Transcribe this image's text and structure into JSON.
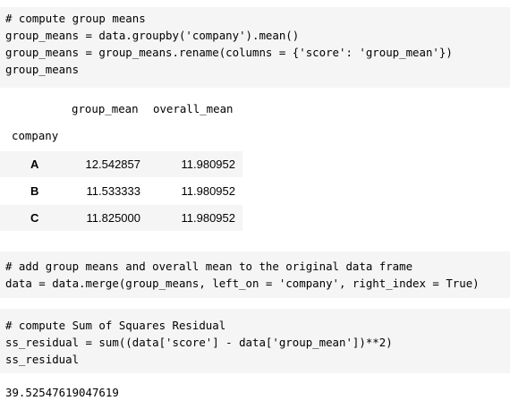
{
  "cell1": {
    "lines": [
      "# compute group means",
      "group_means = data.groupby('company').mean()",
      "group_means = group_means.rename(columns = {'score': 'group_mean'})",
      "group_means"
    ]
  },
  "dataframe": {
    "columns": [
      "group_mean",
      "overall_mean"
    ],
    "index_name": "company",
    "rows": [
      {
        "index": "A",
        "group_mean": "12.542857",
        "overall_mean": "11.980952"
      },
      {
        "index": "B",
        "group_mean": "11.533333",
        "overall_mean": "11.980952"
      },
      {
        "index": "C",
        "group_mean": "11.825000",
        "overall_mean": "11.980952"
      }
    ]
  },
  "cell2": {
    "lines": [
      "# add group means and overall mean to the original data frame",
      "data = data.merge(group_means, left_on = 'company', right_index = True)"
    ]
  },
  "cell3": {
    "lines": [
      "# compute Sum of Squares Residual",
      "ss_residual = sum((data['score'] - data['group_mean'])**2)",
      "ss_residual"
    ]
  },
  "output": {
    "value": "39.52547619047619"
  },
  "colors": {
    "cell_background": "#f5f5f5",
    "page_background": "#ffffff"
  }
}
